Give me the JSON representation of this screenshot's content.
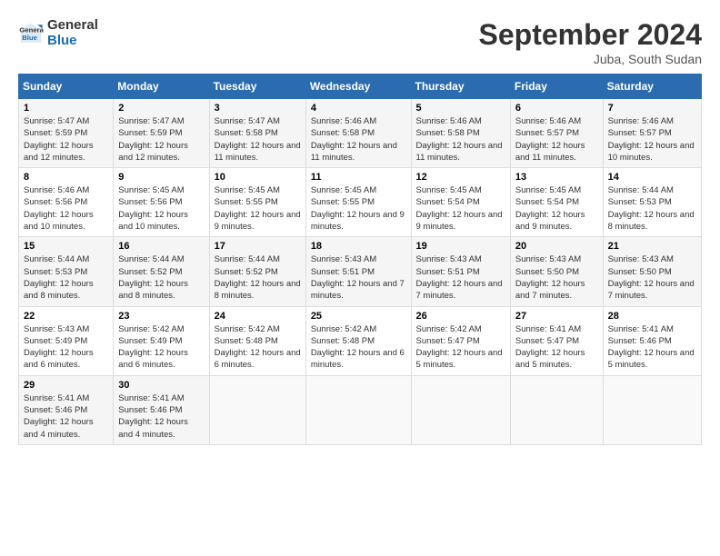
{
  "header": {
    "logo_line1": "General",
    "logo_line2": "Blue",
    "month": "September 2024",
    "location": "Juba, South Sudan"
  },
  "weekdays": [
    "Sunday",
    "Monday",
    "Tuesday",
    "Wednesday",
    "Thursday",
    "Friday",
    "Saturday"
  ],
  "weeks": [
    [
      {
        "day": "1",
        "rise": "5:47 AM",
        "set": "5:59 PM",
        "daylight": "12 hours and 12 minutes."
      },
      {
        "day": "2",
        "rise": "5:47 AM",
        "set": "5:59 PM",
        "daylight": "12 hours and 12 minutes."
      },
      {
        "day": "3",
        "rise": "5:47 AM",
        "set": "5:58 PM",
        "daylight": "12 hours and 11 minutes."
      },
      {
        "day": "4",
        "rise": "5:46 AM",
        "set": "5:58 PM",
        "daylight": "12 hours and 11 minutes."
      },
      {
        "day": "5",
        "rise": "5:46 AM",
        "set": "5:58 PM",
        "daylight": "12 hours and 11 minutes."
      },
      {
        "day": "6",
        "rise": "5:46 AM",
        "set": "5:57 PM",
        "daylight": "12 hours and 11 minutes."
      },
      {
        "day": "7",
        "rise": "5:46 AM",
        "set": "5:57 PM",
        "daylight": "12 hours and 10 minutes."
      }
    ],
    [
      {
        "day": "8",
        "rise": "5:46 AM",
        "set": "5:56 PM",
        "daylight": "12 hours and 10 minutes."
      },
      {
        "day": "9",
        "rise": "5:45 AM",
        "set": "5:56 PM",
        "daylight": "12 hours and 10 minutes."
      },
      {
        "day": "10",
        "rise": "5:45 AM",
        "set": "5:55 PM",
        "daylight": "12 hours and 9 minutes."
      },
      {
        "day": "11",
        "rise": "5:45 AM",
        "set": "5:55 PM",
        "daylight": "12 hours and 9 minutes."
      },
      {
        "day": "12",
        "rise": "5:45 AM",
        "set": "5:54 PM",
        "daylight": "12 hours and 9 minutes."
      },
      {
        "day": "13",
        "rise": "5:45 AM",
        "set": "5:54 PM",
        "daylight": "12 hours and 9 minutes."
      },
      {
        "day": "14",
        "rise": "5:44 AM",
        "set": "5:53 PM",
        "daylight": "12 hours and 8 minutes."
      }
    ],
    [
      {
        "day": "15",
        "rise": "5:44 AM",
        "set": "5:53 PM",
        "daylight": "12 hours and 8 minutes."
      },
      {
        "day": "16",
        "rise": "5:44 AM",
        "set": "5:52 PM",
        "daylight": "12 hours and 8 minutes."
      },
      {
        "day": "17",
        "rise": "5:44 AM",
        "set": "5:52 PM",
        "daylight": "12 hours and 8 minutes."
      },
      {
        "day": "18",
        "rise": "5:43 AM",
        "set": "5:51 PM",
        "daylight": "12 hours and 7 minutes."
      },
      {
        "day": "19",
        "rise": "5:43 AM",
        "set": "5:51 PM",
        "daylight": "12 hours and 7 minutes."
      },
      {
        "day": "20",
        "rise": "5:43 AM",
        "set": "5:50 PM",
        "daylight": "12 hours and 7 minutes."
      },
      {
        "day": "21",
        "rise": "5:43 AM",
        "set": "5:50 PM",
        "daylight": "12 hours and 7 minutes."
      }
    ],
    [
      {
        "day": "22",
        "rise": "5:43 AM",
        "set": "5:49 PM",
        "daylight": "12 hours and 6 minutes."
      },
      {
        "day": "23",
        "rise": "5:42 AM",
        "set": "5:49 PM",
        "daylight": "12 hours and 6 minutes."
      },
      {
        "day": "24",
        "rise": "5:42 AM",
        "set": "5:48 PM",
        "daylight": "12 hours and 6 minutes."
      },
      {
        "day": "25",
        "rise": "5:42 AM",
        "set": "5:48 PM",
        "daylight": "12 hours and 6 minutes."
      },
      {
        "day": "26",
        "rise": "5:42 AM",
        "set": "5:47 PM",
        "daylight": "12 hours and 5 minutes."
      },
      {
        "day": "27",
        "rise": "5:41 AM",
        "set": "5:47 PM",
        "daylight": "12 hours and 5 minutes."
      },
      {
        "day": "28",
        "rise": "5:41 AM",
        "set": "5:46 PM",
        "daylight": "12 hours and 5 minutes."
      }
    ],
    [
      {
        "day": "29",
        "rise": "5:41 AM",
        "set": "5:46 PM",
        "daylight": "12 hours and 4 minutes."
      },
      {
        "day": "30",
        "rise": "5:41 AM",
        "set": "5:46 PM",
        "daylight": "12 hours and 4 minutes."
      },
      null,
      null,
      null,
      null,
      null
    ]
  ]
}
